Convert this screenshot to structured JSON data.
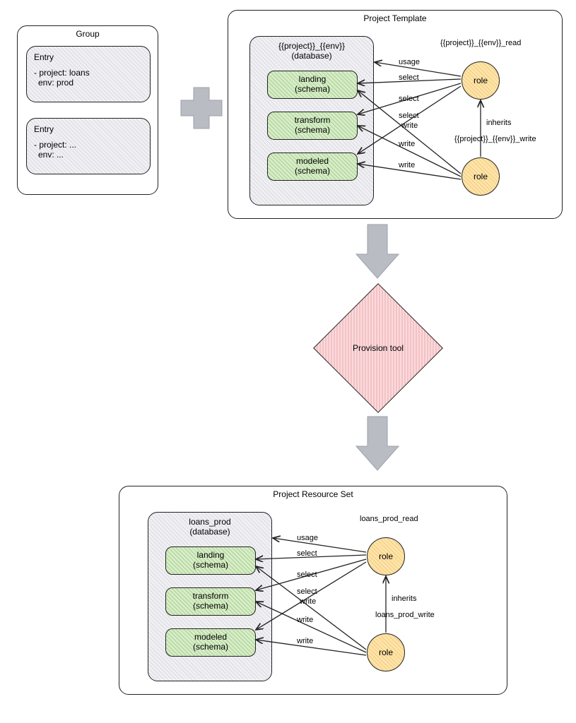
{
  "group": {
    "title": "Group",
    "entry1_title": "Entry",
    "entry1_line1": "- project: loans",
    "entry1_line2": "env: prod",
    "entry2_title": "Entry",
    "entry2_line1": "- project: ...",
    "entry2_line2": "env: ..."
  },
  "template": {
    "title": "Project Template",
    "db_title": "{{project}}_{{env}}",
    "db_sub": "(database)",
    "schema1": "landing",
    "schema2": "transform",
    "schema3": "modeled",
    "schema_sub": "(schema)",
    "role_label": "role",
    "read_name": "{{project}}_{{env}}_read",
    "write_name": "{{project}}_{{env}}_write",
    "edge_usage": "usage",
    "edge_select": "select",
    "edge_write": "write",
    "edge_inherits": "inherits"
  },
  "provision": {
    "label": "Provision tool"
  },
  "resource": {
    "title": "Project Resource Set",
    "db_title": "loans_prod",
    "db_sub": "(database)",
    "schema1": "landing",
    "schema2": "transform",
    "schema3": "modeled",
    "schema_sub": "(schema)",
    "role_label": "role",
    "read_name": "loans_prod_read",
    "write_name": "loans_prod_write",
    "edge_usage": "usage",
    "edge_select": "select",
    "edge_write": "write",
    "edge_inherits": "inherits"
  }
}
